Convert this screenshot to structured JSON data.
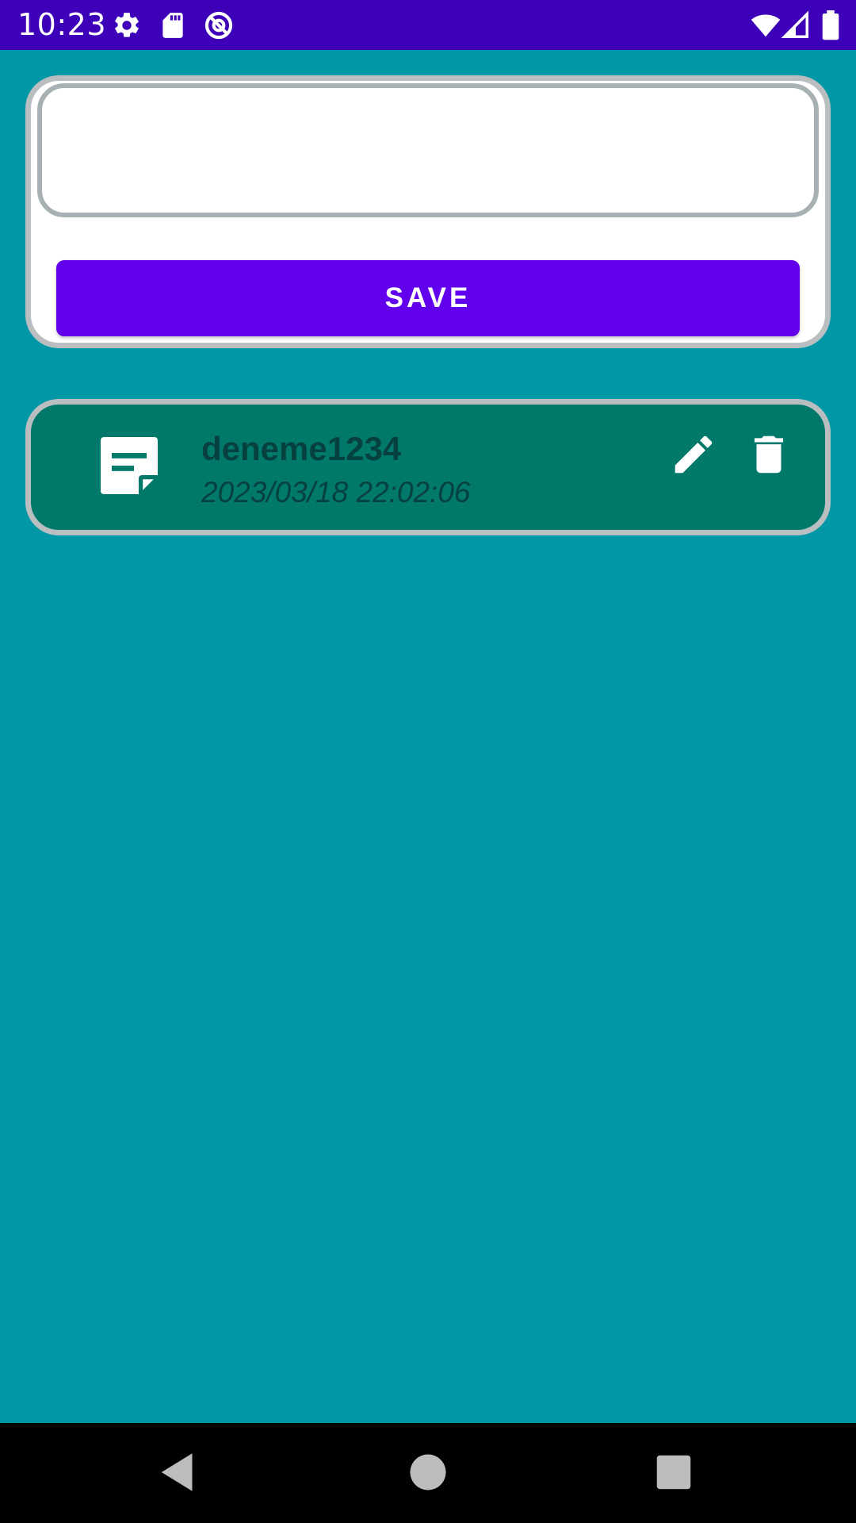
{
  "status_bar": {
    "time": "10:23",
    "left_icons": [
      "settings-icon",
      "sd-card-icon",
      "at-sign-icon"
    ],
    "right_icons": [
      "wifi-icon",
      "signal-icon",
      "battery-icon"
    ],
    "color": "#3d00b8"
  },
  "editor": {
    "input_value": "",
    "save_label": "SAVE",
    "button_color": "#6200ee"
  },
  "notes": [
    {
      "title": "deneme1234",
      "date": "2023/03/18 22:02:06",
      "icon": "note-document-icon",
      "actions": [
        "edit-icon",
        "delete-icon"
      ],
      "color": "#00796b"
    }
  ],
  "nav_bar": {
    "buttons": [
      "back-icon",
      "home-icon",
      "recents-icon"
    ]
  },
  "background_color": "#0097a7"
}
